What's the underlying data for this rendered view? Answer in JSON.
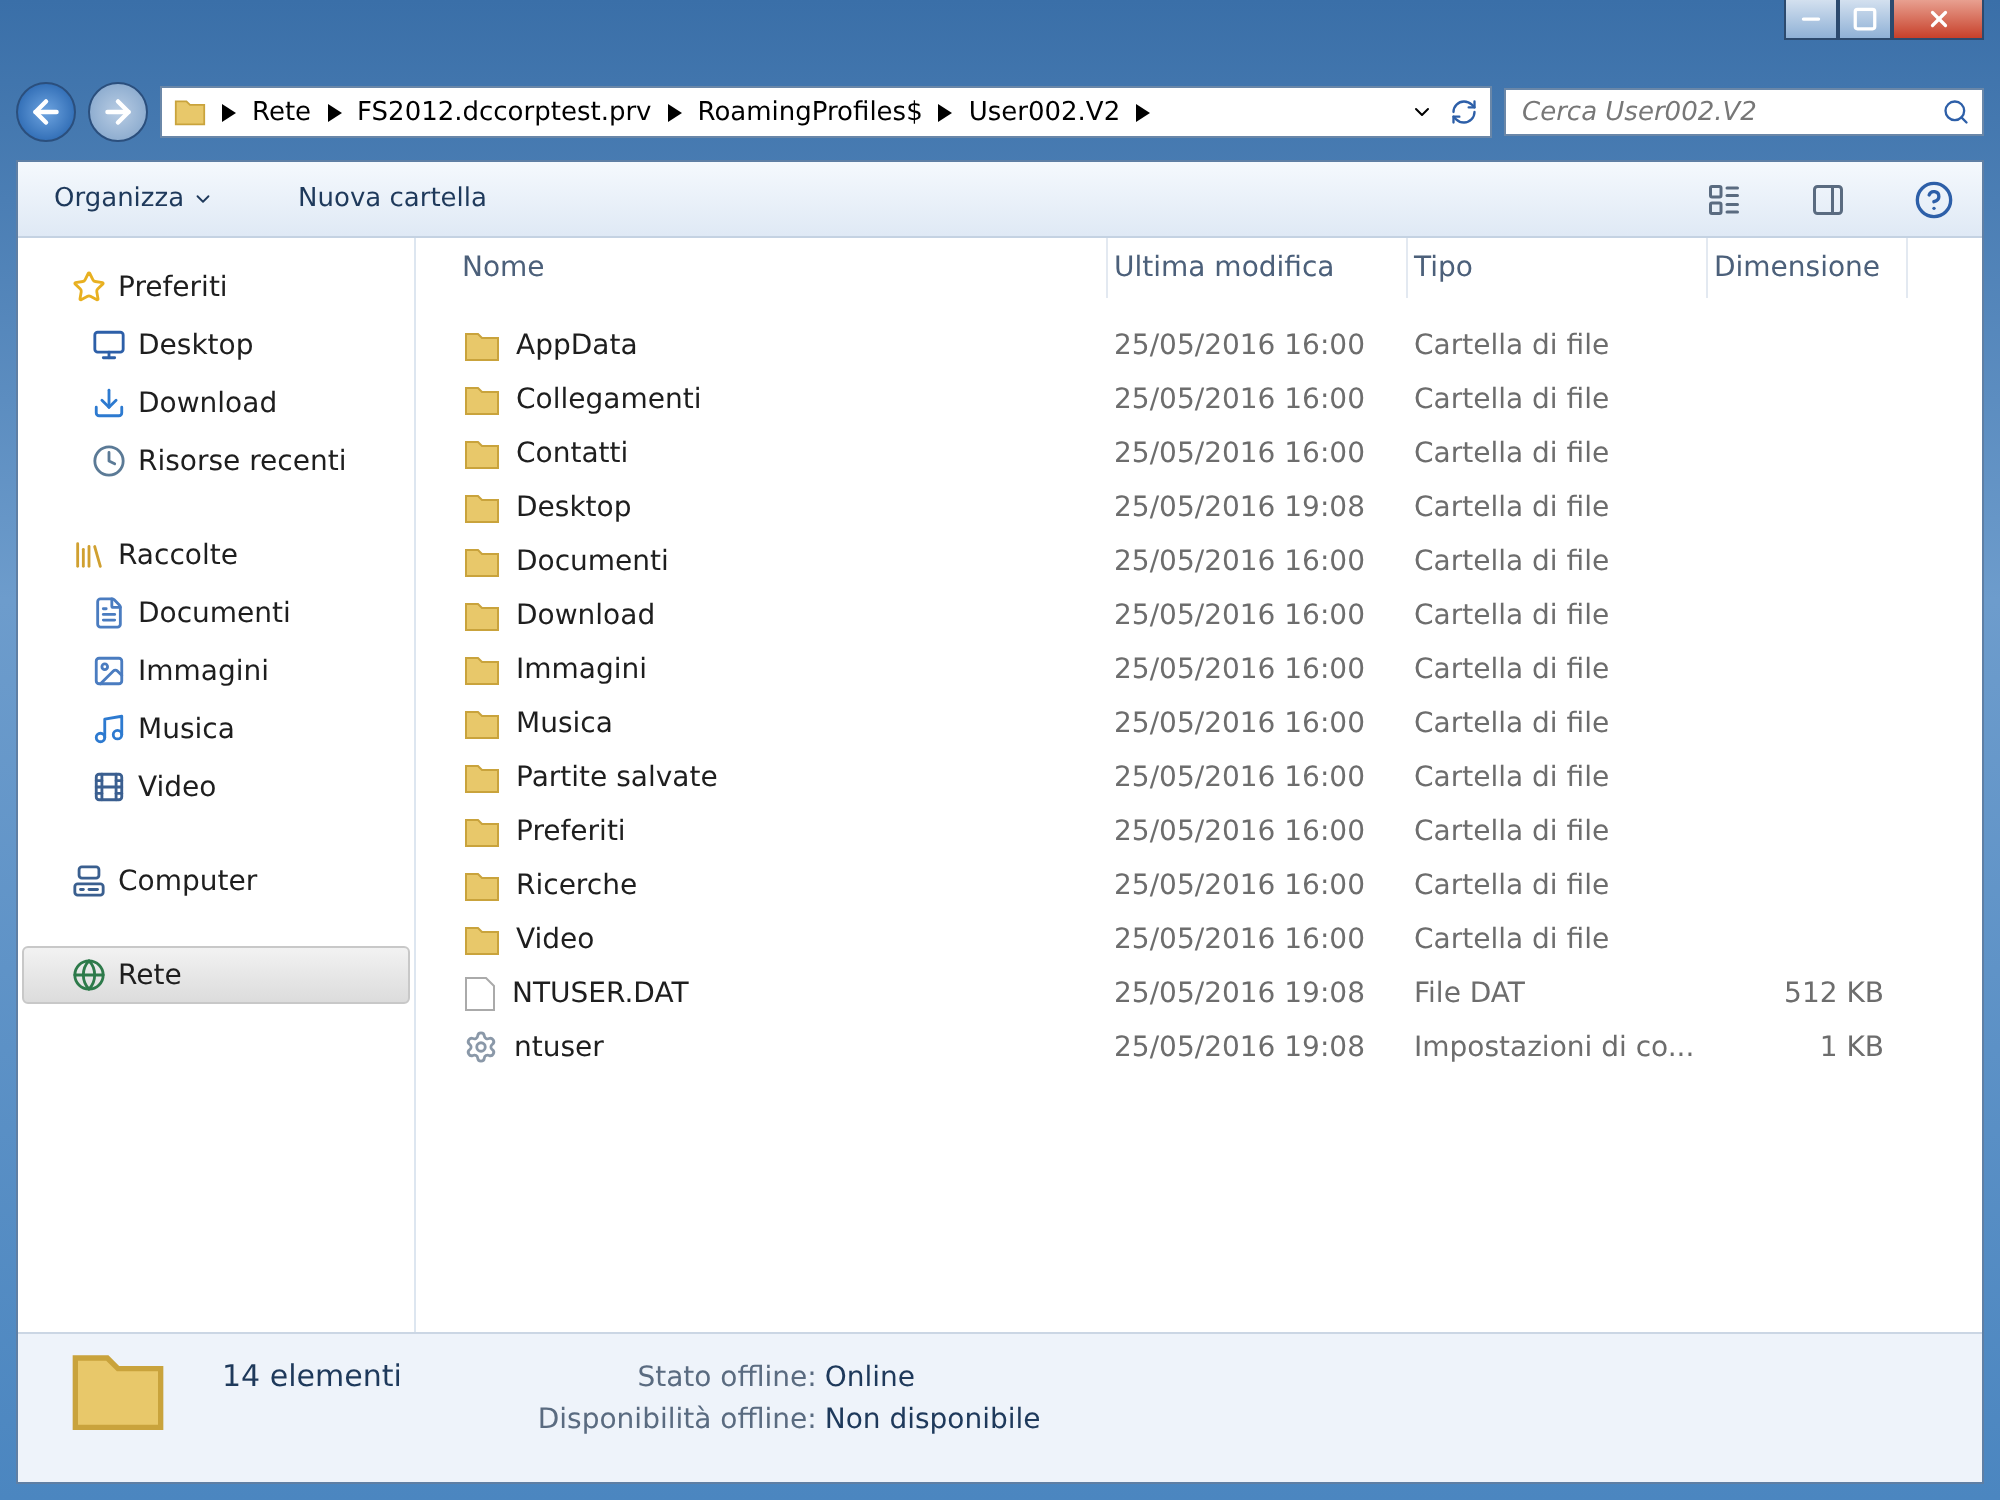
{
  "address": {
    "segments": [
      "Rete",
      "FS2012.dccorptest.prv",
      "RoamingProfiles$",
      "User002.V2"
    ]
  },
  "search": {
    "placeholder": "Cerca User002.V2"
  },
  "toolbar": {
    "organize": "Organizza",
    "new_folder": "Nuova cartella"
  },
  "sidebar": {
    "groups": [
      {
        "label": "Preferiti",
        "kind": "star",
        "selected": false,
        "items": [
          {
            "label": "Desktop",
            "kind": "desktop",
            "selected": false
          },
          {
            "label": "Download",
            "kind": "download",
            "selected": false
          },
          {
            "label": "Risorse recenti",
            "kind": "recent",
            "selected": false
          }
        ]
      },
      {
        "label": "Raccolte",
        "kind": "library",
        "selected": false,
        "items": [
          {
            "label": "Documenti",
            "kind": "document",
            "selected": false
          },
          {
            "label": "Immagini",
            "kind": "image",
            "selected": false
          },
          {
            "label": "Musica",
            "kind": "music",
            "selected": false
          },
          {
            "label": "Video",
            "kind": "video",
            "selected": false
          }
        ]
      },
      {
        "label": "Computer",
        "kind": "computer",
        "selected": false
      },
      {
        "label": "Rete",
        "kind": "network",
        "selected": true
      }
    ]
  },
  "table": {
    "columns": [
      "Nome",
      "Ultima modifica",
      "Tipo",
      "Dimensione"
    ],
    "rows": [
      {
        "kind": "folder",
        "name": "AppData",
        "modified": "25/05/2016 16:00",
        "type": "Cartella di file"
      },
      {
        "kind": "folder",
        "name": "Collegamenti",
        "modified": "25/05/2016 16:00",
        "type": "Cartella di file"
      },
      {
        "kind": "folder",
        "name": "Contatti",
        "modified": "25/05/2016 16:00",
        "type": "Cartella di file"
      },
      {
        "kind": "folder",
        "name": "Desktop",
        "modified": "25/05/2016 19:08",
        "type": "Cartella di file"
      },
      {
        "kind": "folder",
        "name": "Documenti",
        "modified": "25/05/2016 16:00",
        "type": "Cartella di file"
      },
      {
        "kind": "folder",
        "name": "Download",
        "modified": "25/05/2016 16:00",
        "type": "Cartella di file"
      },
      {
        "kind": "folder",
        "name": "Immagini",
        "modified": "25/05/2016 16:00",
        "type": "Cartella di file"
      },
      {
        "kind": "folder",
        "name": "Musica",
        "modified": "25/05/2016 16:00",
        "type": "Cartella di file"
      },
      {
        "kind": "folder",
        "name": "Partite salvate",
        "modified": "25/05/2016 16:00",
        "type": "Cartella di file"
      },
      {
        "kind": "folder",
        "name": "Preferiti",
        "modified": "25/05/2016 16:00",
        "type": "Cartella di file"
      },
      {
        "kind": "folder",
        "name": "Ricerche",
        "modified": "25/05/2016 16:00",
        "type": "Cartella di file"
      },
      {
        "kind": "folder",
        "name": "Video",
        "modified": "25/05/2016 16:00",
        "type": "Cartella di file"
      },
      {
        "kind": "file",
        "name": "NTUSER.DAT",
        "modified": "25/05/2016 19:08",
        "type": "File DAT",
        "size": "512 KB"
      },
      {
        "kind": "settings",
        "name": "ntuser",
        "modified": "25/05/2016 19:08",
        "type": "Impostazioni di co...",
        "size": "1 KB"
      }
    ]
  },
  "details": {
    "count": "14 elementi",
    "fields": [
      {
        "label": "Stato offline:",
        "value": "Online"
      },
      {
        "label": "Disponibilità offline:",
        "value": "Non disponibile"
      }
    ]
  }
}
